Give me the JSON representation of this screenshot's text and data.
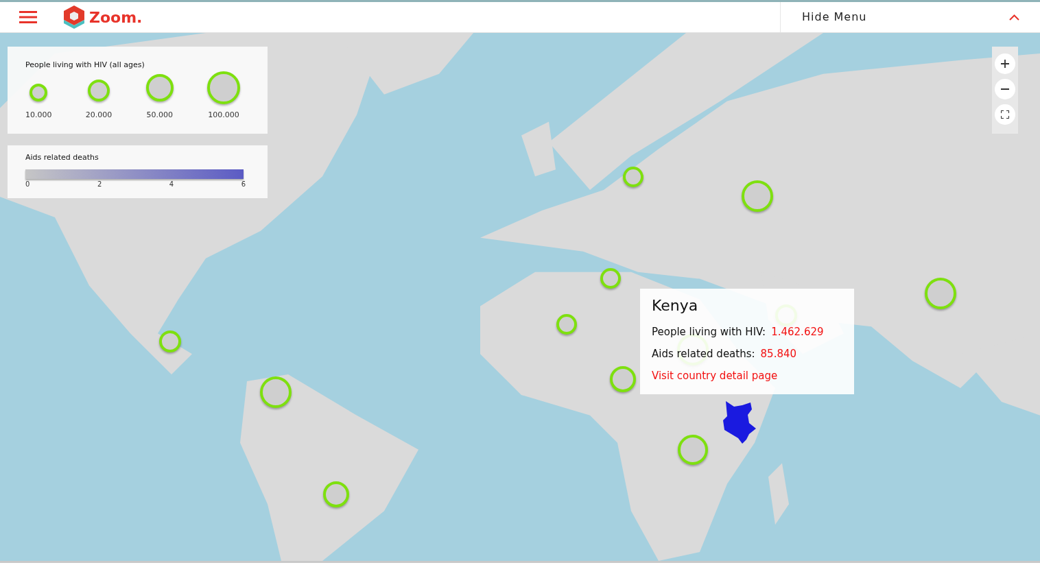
{
  "header": {
    "brand": "Zoom.",
    "menu_toggle": "Hide Menu"
  },
  "legend_size": {
    "title": "People living with HIV (all ages)",
    "items": [
      {
        "label": "10.000",
        "kind": "s"
      },
      {
        "label": "20.000",
        "kind": "m"
      },
      {
        "label": "50.000",
        "kind": "l"
      },
      {
        "label": "100.000",
        "kind": "xl"
      }
    ]
  },
  "legend_color": {
    "title": "Aids related deaths",
    "ticks": [
      "0",
      "2",
      "4",
      "6"
    ]
  },
  "tooltip": {
    "title": "Kenya",
    "rows": [
      {
        "label": "People living with HIV:",
        "value": "1.462.629"
      },
      {
        "label": "Aids related deaths:",
        "value": "85.840"
      }
    ],
    "link": "Visit country detail page"
  }
}
